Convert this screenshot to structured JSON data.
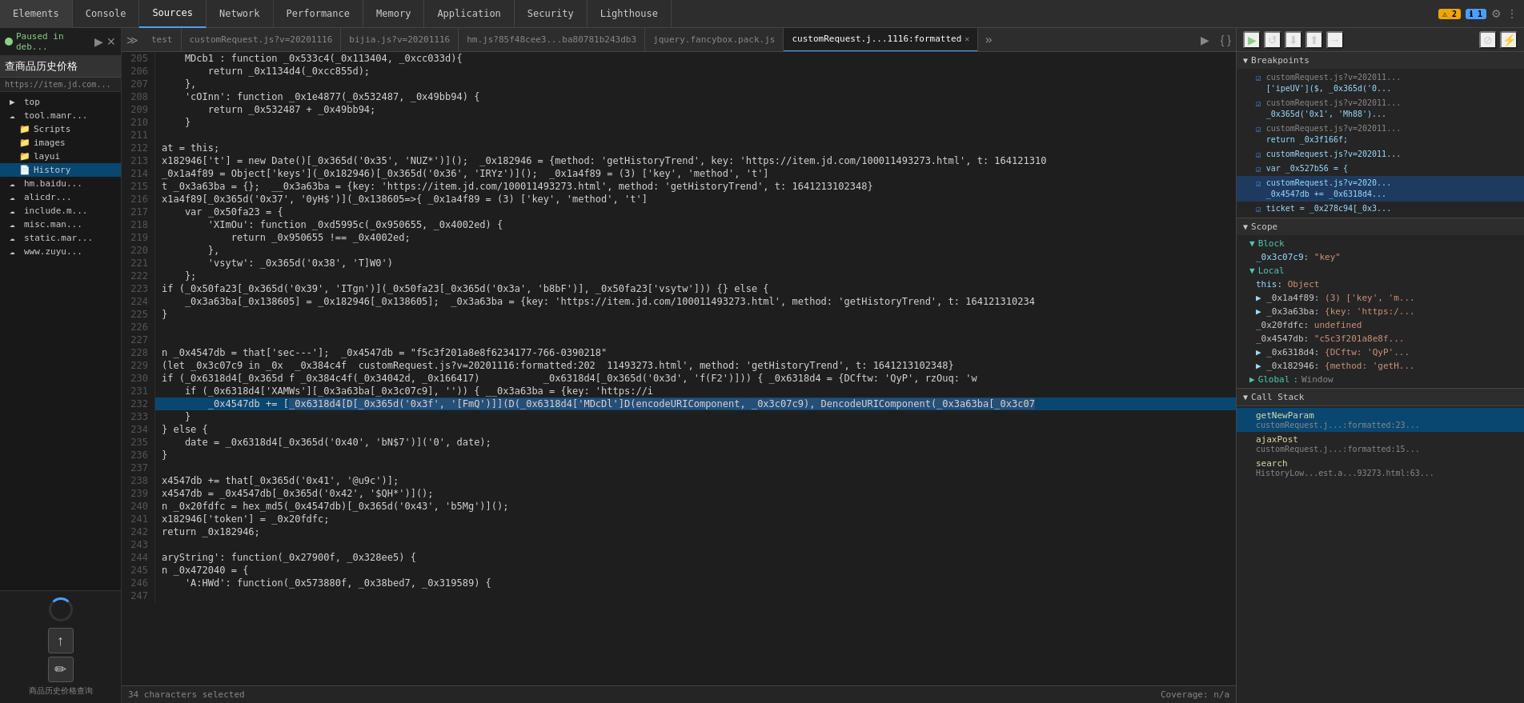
{
  "topbar": {
    "tabs": [
      {
        "label": "Elements",
        "active": false
      },
      {
        "label": "Console",
        "active": false
      },
      {
        "label": "Sources",
        "active": true
      },
      {
        "label": "Network",
        "active": false
      },
      {
        "label": "Performance",
        "active": false
      },
      {
        "label": "Memory",
        "active": false
      },
      {
        "label": "Application",
        "active": false
      },
      {
        "label": "Security",
        "active": false
      },
      {
        "label": "Lighthouse",
        "active": false
      }
    ],
    "warning_count": "2",
    "info_count": "1"
  },
  "left_panel": {
    "paused_label": "Paused in deb...",
    "url": "https://item.jd.com...",
    "nav_label": "查商品历史价格",
    "tree": [
      {
        "label": "top",
        "level": 1,
        "icon": "▶",
        "type": "folder"
      },
      {
        "label": "tool.manr...",
        "level": 1,
        "icon": "☁",
        "type": "domain"
      },
      {
        "label": "Scripts",
        "level": 2,
        "icon": "📁",
        "type": "folder"
      },
      {
        "label": "images",
        "level": 2,
        "icon": "📁",
        "type": "folder"
      },
      {
        "label": "layui",
        "level": 2,
        "icon": "📁",
        "type": "folder"
      },
      {
        "label": "History",
        "level": 2,
        "icon": "📄",
        "type": "file",
        "selected": true
      },
      {
        "label": "hm.baidu...",
        "level": 1,
        "icon": "☁",
        "type": "domain"
      },
      {
        "label": "alicdr...",
        "level": 1,
        "icon": "☁",
        "type": "domain"
      },
      {
        "label": "include.m...",
        "level": 1,
        "icon": "☁",
        "type": "domain"
      },
      {
        "label": "misc.man...",
        "level": 1,
        "icon": "☁",
        "type": "domain"
      },
      {
        "label": "static.mar...",
        "level": 1,
        "icon": "☁",
        "type": "domain"
      },
      {
        "label": "www.zuyu...",
        "level": 1,
        "icon": "☁",
        "type": "domain"
      }
    ],
    "bottom_label": "商品历史价格查询"
  },
  "file_tabs": [
    {
      "label": "test",
      "active": false
    },
    {
      "label": "customRequest.js?v=20201116",
      "active": false
    },
    {
      "label": "bijia.js?v=20201116",
      "active": false
    },
    {
      "label": "hm.js?85f48cee3...ba80781b243db3",
      "active": false
    },
    {
      "label": "jquery.fancybox.pack.js",
      "active": false
    },
    {
      "label": "customRequest.j...1116:formatted",
      "active": true,
      "closeable": true
    }
  ],
  "code": {
    "lines": [
      {
        "n": 205,
        "text": "    MDcb1 : function _0x533c4(_0x113404, _0xcc033d){"
      },
      {
        "n": 206,
        "text": "        return _0x1134d4(_0xcc855d);"
      },
      {
        "n": 207,
        "text": "    },"
      },
      {
        "n": 208,
        "text": "    'cOInn': function _0x1e4877(_0x532487, _0x49bb94) {"
      },
      {
        "n": 209,
        "text": "        return _0x532487 + _0x49bb94;"
      },
      {
        "n": 210,
        "text": "    }"
      },
      {
        "n": 211,
        "text": ""
      },
      {
        "n": 212,
        "text": "at = this;"
      },
      {
        "n": 213,
        "text": "x182946['t'] = new Date()[_0x365d('0x35', 'NUZ*')]();  _0x182946 = {method: 'getHistoryTrend', key: 'https://item.jd.com/100011493273.html', t: 164121310"
      },
      {
        "n": 214,
        "text": "_0x1a4f89 = Object['keys'](_0x182946)[_0x365d('0x36', 'IRYz')]();  _0x1a4f89 = (3) ['key', 'method', 't']"
      },
      {
        "n": 215,
        "text": "t _0x3a63ba = {};  __0x3a63ba = {key: 'https://item.jd.com/100011493273.html', method: 'getHistoryTrend', t: 1641213102348}"
      },
      {
        "n": 216,
        "text": "x1a4f89[_0x365d('0x37', '0yH$')](_0x138605=>{ _0x1a4f89 = (3) ['key', 'method', 't']"
      },
      {
        "n": 217,
        "text": "    var _0x50fa23 = {"
      },
      {
        "n": 218,
        "text": "        'XImOu': function _0xd5995c(_0x950655, _0x4002ed) {"
      },
      {
        "n": 219,
        "text": "            return _0x950655 !== _0x4002ed;"
      },
      {
        "n": 220,
        "text": "        },"
      },
      {
        "n": 221,
        "text": "        'vsytw': _0x365d('0x38', 'T]W0')"
      },
      {
        "n": 222,
        "text": "    };"
      },
      {
        "n": 223,
        "text": "if (_0x50fa23[_0x365d('0x39', 'ITgn')](_0x50fa23[_0x365d('0x3a', 'b8bF')], _0x50fa23['vsytw'])) {} else {"
      },
      {
        "n": 224,
        "text": "    _0x3a63ba[_0x138605] = _0x182946[_0x138605];  _0x3a63ba = {key: 'https://item.jd.com/100011493273.html', method: 'getHistoryTrend', t: 164121310234"
      },
      {
        "n": 225,
        "text": "}"
      },
      {
        "n": 226,
        "text": ""
      },
      {
        "n": 227,
        "text": ""
      },
      {
        "n": 228,
        "text": "n _0x4547db = that['sec---'];  _0x4547db = \"f5c3f201a8e8f6234177-766-0390218\""
      },
      {
        "n": 229,
        "text": "(let _0x3c07c9 in _0x  _0x384c4f  customRequest.js?v=20201116:formatted:202  11493273.html', method: 'getHistoryTrend', t: 1641213102348}"
      },
      {
        "n": 230,
        "text": "if (_0x6318d4[_0x365d f _0x384c4f(_0x34042d, _0x166417)           _0x6318d4[_0x365d('0x3d', 'f(F2')])) { _0x6318d4 = {DCftw: 'QyP', rzOuq: 'w"
      },
      {
        "n": 231,
        "text": "    if (_0x6318d4['XAMWs'][_0x3a63ba[_0x3c07c9], '')) { __0x3a63ba = {key: 'https://i"
      },
      {
        "n": 232,
        "text": "        _0x4547db += [_0x6318d4[D[_0x365d('0x3f', '[FmQ')]](D(_0x6318d4['MDcDl']D(encodeURIComponent, _0x3c07c9), DencodeURIComponent(_0x3a63ba[_0x3c07",
        "highlighted": true
      },
      {
        "n": 233,
        "text": "    }"
      },
      {
        "n": 234,
        "text": "} else {"
      },
      {
        "n": 235,
        "text": "    date = _0x6318d4[_0x365d('0x40', 'bN$7')]('0', date);"
      },
      {
        "n": 236,
        "text": "}"
      },
      {
        "n": 237,
        "text": ""
      },
      {
        "n": 238,
        "text": "x4547db += that[_0x365d('0x41', '@u9c')];"
      },
      {
        "n": 239,
        "text": "x4547db = _0x4547db[_0x365d('0x42', '$QH*')]();"
      },
      {
        "n": 240,
        "text": "n _0x20fdfc = hex_md5(_0x4547db)[_0x365d('0x43', 'b5Mg')]();"
      },
      {
        "n": 241,
        "text": "x182946['token'] = _0x20fdfc;"
      },
      {
        "n": 242,
        "text": "return _0x182946;"
      },
      {
        "n": 243,
        "text": ""
      },
      {
        "n": 244,
        "text": "aryString': function(_0x27900f, _0x328ee5) {"
      },
      {
        "n": 245,
        "text": "n _0x472040 = {"
      },
      {
        "n": 246,
        "text": "    'A:HWd': function(_0x573880f, _0x38bed7, _0x319589) {"
      },
      {
        "n": 247,
        "text": ""
      }
    ],
    "selected_chars": "34 characters selected"
  },
  "right_panel": {
    "debug_buttons": [
      {
        "icon": "▶",
        "title": "Resume",
        "name": "resume-btn"
      },
      {
        "icon": "↺",
        "title": "Step over",
        "name": "step-over-btn"
      },
      {
        "icon": "↓",
        "title": "Step into",
        "name": "step-into-btn"
      },
      {
        "icon": "↑",
        "title": "Step out",
        "name": "step-out-btn"
      },
      {
        "icon": "⟶",
        "title": "Step",
        "name": "step-btn"
      },
      {
        "icon": "⊘",
        "title": "Deactivate",
        "name": "deactivate-btn"
      }
    ],
    "breakpoints_label": "Breakpoints",
    "breakpoints": [
      {
        "checked": true,
        "file": "customRequest.js?v=202011...",
        "code": "['ipeUV']($, _0x365d('0..."
      },
      {
        "checked": true,
        "file": "customRequest.js?v=202011...",
        "code": "_0x365d('0x1', 'Mh88')..."
      },
      {
        "checked": true,
        "file": "customRequest.js?v=202011...",
        "code": "return _0x3f166f;"
      },
      {
        "checked": true,
        "file": "customRequest.js?v=202011...",
        "code": "customRequest.js?v=202011..."
      },
      {
        "checked": true,
        "file": "customRequest.js?v=202011...",
        "code": "var _0x527b56 = {"
      },
      {
        "checked": true,
        "file": "customRequest.js?v=2020...",
        "code": "_0x4547db += _0x6318d4...",
        "active": true
      },
      {
        "checked": true,
        "file": "customRequest.js?v=202011...",
        "code": "ticket = _0x278c94[_0x3..."
      }
    ],
    "scope_label": "Scope",
    "scope_sections": [
      {
        "label": "Block",
        "items": [
          {
            "key": "_0x3c07c9",
            "value": "\"key\""
          }
        ]
      },
      {
        "label": "Local",
        "items": [
          {
            "key": "this",
            "value": "Object"
          },
          {
            "key": "_0x1a4f89",
            "value": "(3) ['key', 'm..."
          },
          {
            "key": "_0x3a63ba",
            "value": "{key: 'https:/..."
          },
          {
            "key": "_0x20fdfc",
            "value": "undefined"
          },
          {
            "key": "_0x4547db",
            "value": "\"c5c3f201a8e8f..."
          },
          {
            "key": "_0x6318d4",
            "value": "{DCftw: 'QyP'..."
          },
          {
            "key": "_0x182946",
            "value": "{method: 'getH..."
          }
        ]
      },
      {
        "label": "Global",
        "value": "Window"
      }
    ],
    "call_stack_label": "Call Stack",
    "call_stack": [
      {
        "fn": "getNewParam",
        "file": "customRequest.j...:formatted:23...",
        "active": true
      },
      {
        "fn": "ajaxPost",
        "file": "customRequest.j...:formatted:15..."
      },
      {
        "fn": "search",
        "file": "HistoryLow...est.a...93273.html:63..."
      }
    ]
  },
  "status_bar": {
    "chars_selected": "34 characters selected",
    "coverage": "Coverage: n/a"
  },
  "tooltip": {
    "text": "customRequest.js?v=20201116:formatted:202"
  }
}
